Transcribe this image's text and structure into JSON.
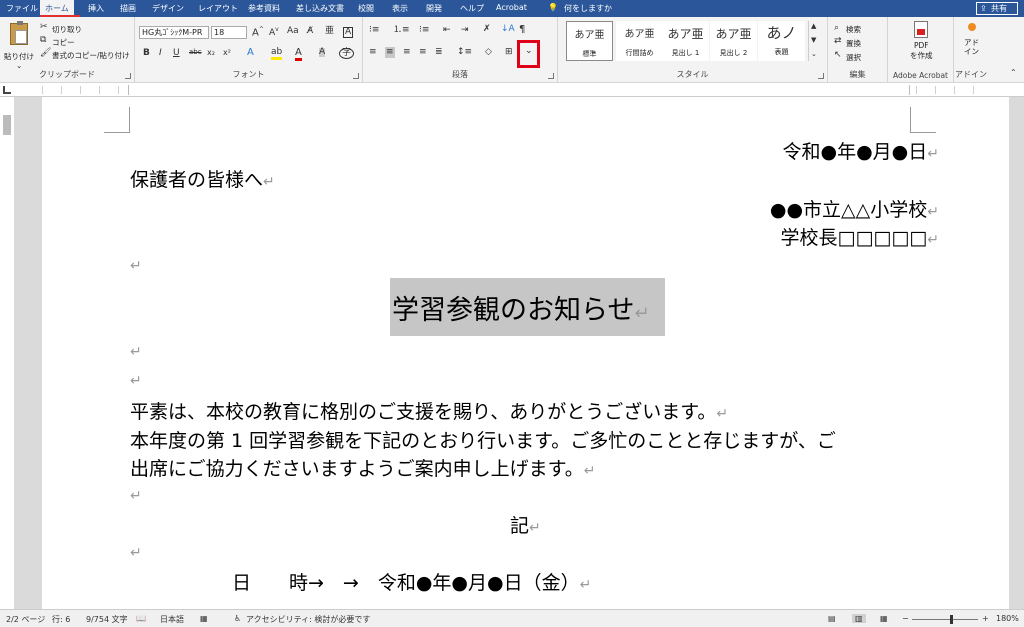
{
  "tabs": [
    {
      "label": "ファイル",
      "active": false
    },
    {
      "label": "ホーム",
      "active": true
    },
    {
      "label": "挿入",
      "active": false
    },
    {
      "label": "描画",
      "active": false
    },
    {
      "label": "デザイン",
      "active": false
    },
    {
      "label": "レイアウト",
      "active": false
    },
    {
      "label": "参考資料",
      "active": false
    },
    {
      "label": "差し込み文書",
      "active": false
    },
    {
      "label": "校閲",
      "active": false
    },
    {
      "label": "表示",
      "active": false
    },
    {
      "label": "開発",
      "active": false
    },
    {
      "label": "ヘルプ",
      "active": false
    },
    {
      "label": "Acrobat",
      "active": false
    }
  ],
  "tell_me": "何をしますか",
  "share_label": "共有",
  "clipboard": {
    "paste": "貼り付け",
    "cut": "切り取り",
    "copy": "コピー",
    "format_painter": "書式のコピー/貼り付け",
    "label": "クリップボード"
  },
  "font": {
    "name": "HG丸ｺﾞｼｯｸM-PR",
    "size": "18",
    "label": "フォント"
  },
  "paragraph": {
    "label": "段落"
  },
  "styles": {
    "items": [
      {
        "preview": "あア亜",
        "name": "標準"
      },
      {
        "preview": "あア亜",
        "name": "行間詰め"
      },
      {
        "preview": "あア亜",
        "name": "見出し 1"
      },
      {
        "preview": "あア亜",
        "name": "見出し 2"
      },
      {
        "preview": "あノ",
        "name": "表題"
      }
    ],
    "label": "スタイル"
  },
  "editing": {
    "find": "検索",
    "replace": "置換",
    "select": "選択",
    "label": "編集"
  },
  "acrobat": {
    "pdf": "PDF",
    "create": "を作成",
    "label": "Adobe Acrobat"
  },
  "addin": {
    "line1": "アド",
    "line2": "イン",
    "label": "アドイン"
  },
  "document": {
    "date": "令和●年●月●日",
    "greeting": "保護者の皆様へ",
    "school": "●●市立△△小学校",
    "principal": "学校長□□□□□",
    "title": "学習参観のお知らせ",
    "body1": "平素は、本校の教育に格別のご支援を賜り、ありがとうございます。",
    "body2": "本年度の第 1 回学習参観を下記のとおり行います。ご多忙のことと存じますが、ご",
    "body3": "出席にご協力くださいますようご案内申し上げます。",
    "ki": "記",
    "datetime_label": "日　　時→　→　令和●年●月●日（金）"
  },
  "status": {
    "page": "2/2 ページ",
    "line": "行: 6",
    "words": "9/754 文字",
    "lang": "日本語",
    "accessibility": "アクセシビリティ: 検討が必要です",
    "zoom": "180%"
  }
}
